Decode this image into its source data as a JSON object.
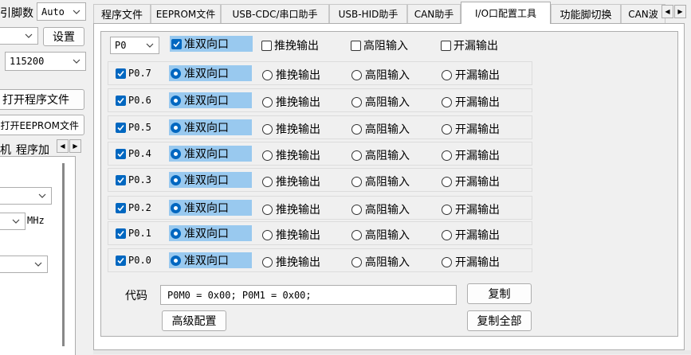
{
  "left_panel": {
    "pin_count_label": "引脚数",
    "pin_count_value": "Auto",
    "settings_button": "设置",
    "baud_value": "115200",
    "open_program_button": "打开程序文件",
    "open_eeprom_button": "打开EEPROM文件",
    "partial_label_1": "机",
    "partial_label_2": "程序加",
    "mhz_label": "MHz"
  },
  "tabs": [
    {
      "label": "程序文件",
      "active": false
    },
    {
      "label": "EEPROM文件",
      "active": false
    },
    {
      "label": "USB-CDC/串口助手",
      "active": false
    },
    {
      "label": "USB-HID助手",
      "active": false
    },
    {
      "label": "CAN助手",
      "active": false
    },
    {
      "label": "I/O口配置工具",
      "active": true
    },
    {
      "label": "功能脚切换",
      "active": false
    },
    {
      "label": "CAN波",
      "active": false
    }
  ],
  "io_tool": {
    "port_select": "P0",
    "header_options": [
      "准双向口",
      "推挽输出",
      "高阻输入",
      "开漏输出"
    ],
    "rows": [
      {
        "pin": "P0.7",
        "mode_labels": [
          "准双向口",
          "推挽输出",
          "高阻输入",
          "开漏输出"
        ]
      },
      {
        "pin": "P0.6",
        "mode_labels": [
          "准双向口",
          "推挽输出",
          "高阻输入",
          "开漏输出"
        ]
      },
      {
        "pin": "P0.5",
        "mode_labels": [
          "准双向口",
          "推挽输出",
          "高阻输入",
          "开漏输出"
        ]
      },
      {
        "pin": "P0.4",
        "mode_labels": [
          "准双向口",
          "推挽输出",
          "高阻输入",
          "开漏输出"
        ]
      },
      {
        "pin": "P0.3",
        "mode_labels": [
          "准双向口",
          "推挽输出",
          "高阻输入",
          "开漏输出"
        ]
      },
      {
        "pin": "P0.2",
        "mode_labels": [
          "准双向口",
          "推挽输出",
          "高阻输入",
          "开漏输出"
        ]
      },
      {
        "pin": "P0.1",
        "mode_labels": [
          "准双向口",
          "推挽输出",
          "高阻输入",
          "开漏输出"
        ]
      },
      {
        "pin": "P0.0",
        "mode_labels": [
          "准双向口",
          "推挽输出",
          "高阻输入",
          "开漏输出"
        ]
      }
    ],
    "code_label": "代码",
    "code_value": "P0M0 = 0x00; P0M1 = 0x00;",
    "copy_button": "复制",
    "advanced_button": "高级配置",
    "copy_all_button": "复制全部"
  },
  "colors": {
    "accent": "#0067c0",
    "selection": "#99c9ef"
  }
}
